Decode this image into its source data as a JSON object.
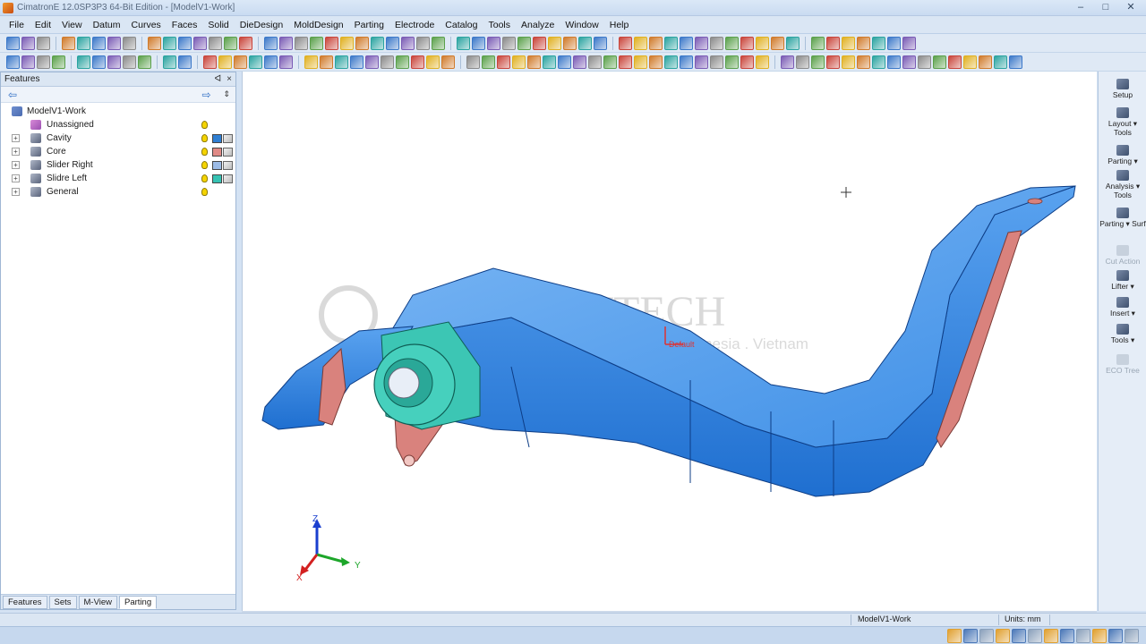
{
  "window": {
    "title": "CimatronE 12.0SP3P3 64-Bit Edition - [ModelV1-Work]",
    "controls": [
      "–",
      "□",
      "✕"
    ]
  },
  "menu": [
    "File",
    "Edit",
    "View",
    "Datum",
    "Curves",
    "Faces",
    "Solid",
    "DieDesign",
    "MoldDesign",
    "Parting",
    "Electrode",
    "Catalog",
    "Tools",
    "Analyze",
    "Window",
    "Help"
  ],
  "features_panel": {
    "title": "Features",
    "pin": "ᐊ",
    "close": "×",
    "nav_back": "⇦",
    "nav_forward": "⇨",
    "nav_menu": "⇕",
    "tree": [
      {
        "label": "ModelV1-Work",
        "level": 0,
        "expander": "",
        "bulb": false,
        "color": ""
      },
      {
        "label": "Unassigned",
        "level": 1,
        "expander": "",
        "bulb": true,
        "color": ""
      },
      {
        "label": "Cavity",
        "level": 1,
        "expander": "+",
        "bulb": true,
        "color": "#2f7fd3"
      },
      {
        "label": "Core",
        "level": 1,
        "expander": "+",
        "bulb": true,
        "color": "#e08a86"
      },
      {
        "label": "Slider Right",
        "level": 1,
        "expander": "+",
        "bulb": true,
        "color": "#9cbbe6"
      },
      {
        "label": "Slidre Left",
        "level": 1,
        "expander": "+",
        "bulb": true,
        "color": "#36c2b3"
      },
      {
        "label": "General",
        "level": 1,
        "expander": "+",
        "bulb": true,
        "color": ""
      }
    ],
    "tabs": [
      "Features",
      "Sets",
      "M-View",
      "Parting"
    ],
    "active_tab": "Parting"
  },
  "viewport": {
    "watermark_title": "MYGROWTECH",
    "watermark_subtitle": "Malaysia . Singapore . Thailand . Indonesia . Vietnam",
    "axis": {
      "x": "X",
      "y": "Y",
      "z": "Z"
    },
    "origin_label": "Default"
  },
  "right_tools": [
    {
      "label": "Setup",
      "enabled": true
    },
    {
      "label": "Layout ▾ Tools",
      "enabled": true
    },
    {
      "label": "Parting ▾",
      "enabled": true
    },
    {
      "label": "Analysis ▾ Tools",
      "enabled": true
    },
    {
      "label": "Parting ▾ Surf",
      "enabled": true
    },
    {
      "label": "Cut Action",
      "enabled": false
    },
    {
      "label": "Lifter ▾",
      "enabled": true
    },
    {
      "label": "Insert ▾",
      "enabled": true
    },
    {
      "label": "Tools ▾",
      "enabled": true
    },
    {
      "label": "ECO Tree",
      "enabled": false
    }
  ],
  "status": {
    "view_name": "ModelV1-Work",
    "units": "Units: mm"
  },
  "colors": {
    "part_blue": "#2f7fde",
    "core_pink": "#d9827d",
    "slider_teal": "#3cc6b4"
  }
}
